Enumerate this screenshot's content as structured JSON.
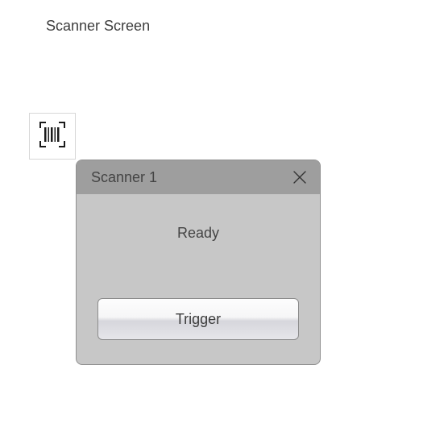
{
  "page": {
    "title": "Scanner Screen"
  },
  "dialog": {
    "title": "Scanner 1",
    "status": "Ready",
    "trigger_label": "Trigger"
  }
}
